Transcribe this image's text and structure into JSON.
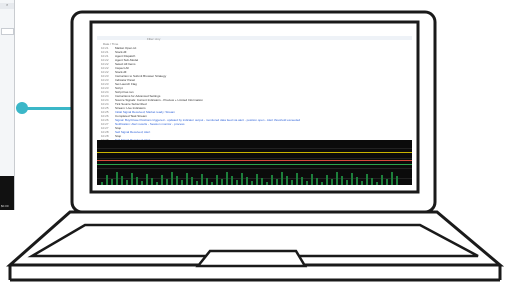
{
  "screen": {
    "title": "",
    "filter_label": "Filter: Any",
    "header": "Date / Time",
    "rows": [
      {
        "time": "10:21",
        "text": "Market Open.txt",
        "style": "normal"
      },
      {
        "time": "10:21",
        "text": "Stock.dll",
        "style": "normal"
      },
      {
        "time": "10:21",
        "text": "Agent Dispatch",
        "style": "normal"
      },
      {
        "time": "10:22",
        "text": "Agent Sub-Model",
        "style": "normal"
      },
      {
        "time": "10:22",
        "text": "Select All Items",
        "style": "normal"
      },
      {
        "time": "10:22",
        "text": "Inspect All",
        "style": "normal"
      },
      {
        "time": "10:22",
        "text": "Stock.dll",
        "style": "normal"
      },
      {
        "time": "10:23",
        "text": "Instruction to Submit Browser Strategy",
        "style": "normal"
      },
      {
        "time": "10:23",
        "text": "Indicator Panel",
        "style": "normal"
      },
      {
        "time": "10:23",
        "text": "Set Launch Flag",
        "style": "normal"
      },
      {
        "time": "10:23",
        "text": "Script",
        "style": "normal"
      },
      {
        "time": "10:24",
        "text": "Script has ran",
        "style": "normal"
      },
      {
        "time": "10:24",
        "text": "Instructions for Advanced Settings",
        "style": "normal"
      },
      {
        "time": "10:24",
        "text": "Source Signals: Current Indicators - Preview + Limited Information",
        "style": "normal"
      },
      {
        "time": "10:24",
        "text": "Tick Source Subscribed",
        "style": "normal"
      },
      {
        "time": "10:25",
        "text": "Stream: Live Indicators",
        "style": "normal"
      },
      {
        "time": "10:25",
        "text": "Initial Signal Received; Market ready: Stream",
        "style": "blue"
      },
      {
        "time": "10:26",
        "text": "Completed Task Stream",
        "style": "normal"
      },
      {
        "time": "10:26",
        "text": "Signal: Buy/Close Positions triggered - updated by indicator output - monitored data feed via alert - position open - Alert threshold exceeded",
        "style": "blue"
      },
      {
        "time": "10:27",
        "text": "Notification: Alert results - Session monitor - process",
        "style": "blue"
      },
      {
        "time": "10:27",
        "text": "Stop",
        "style": "normal"
      },
      {
        "time": "10:28",
        "text": "Sell Signal Received; Alert",
        "style": "blue"
      },
      {
        "time": "10:28",
        "text": "Stop",
        "style": "normal"
      },
      {
        "time": "10:28",
        "text": "Sell Signal Received; Alert",
        "style": "blue"
      },
      {
        "time": "10:29",
        "text": "Additional Actions - Executed",
        "style": "normal"
      },
      {
        "time": "10:29",
        "text": "Instructions Software Protection",
        "style": "normal"
      },
      {
        "time": "10:29",
        "text": "Validated",
        "style": "normal"
      },
      {
        "time": "10:30",
        "text": "Notify Administrator Critical Purchases - Status",
        "style": "normal"
      },
      {
        "time": "10:30",
        "text": "Alert: Position exit complete - review logs",
        "style": "alert"
      }
    ]
  },
  "side_panel": {
    "close_glyph": "×",
    "chart_text": "$0.00"
  },
  "colors": {
    "accent": "#3bb7c8",
    "laptop_stroke": "#1a1a1a",
    "link_blue": "#2f63d8",
    "chart_bg": "#0b0b0b"
  }
}
